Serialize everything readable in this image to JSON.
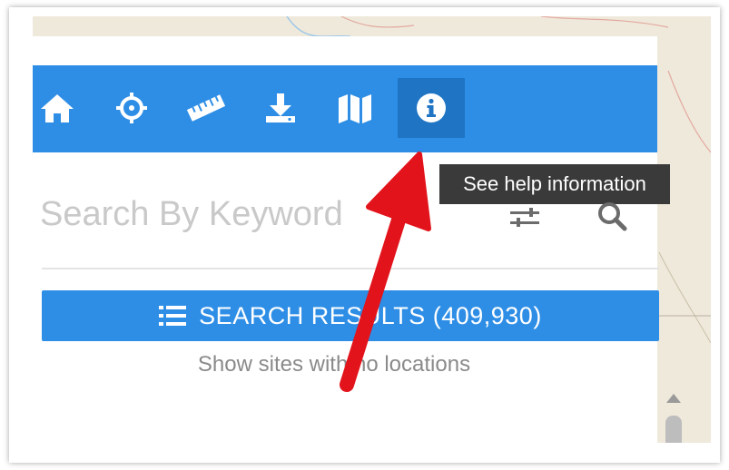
{
  "toolbar": {
    "tools": [
      {
        "name": "home-icon"
      },
      {
        "name": "crosshair-icon"
      },
      {
        "name": "ruler-icon"
      },
      {
        "name": "download-icon"
      },
      {
        "name": "map-icon"
      },
      {
        "name": "info-icon",
        "active": true
      }
    ],
    "tooltip": "See help information"
  },
  "search": {
    "placeholder": "Search By Keyword",
    "filter_icon": "sliders-icon",
    "search_icon": "magnifier-icon"
  },
  "results": {
    "icon": "list-icon",
    "label": "SEARCH RESULTS (409,930)"
  },
  "links": {
    "no_locations": "Show sites with no locations"
  },
  "colors": {
    "toolbar_bg": "#2e8ee6",
    "active_tool_bg": "#1f74c4",
    "tooltip_bg": "#3a3a3a",
    "annotation_arrow": "#e2131b"
  }
}
